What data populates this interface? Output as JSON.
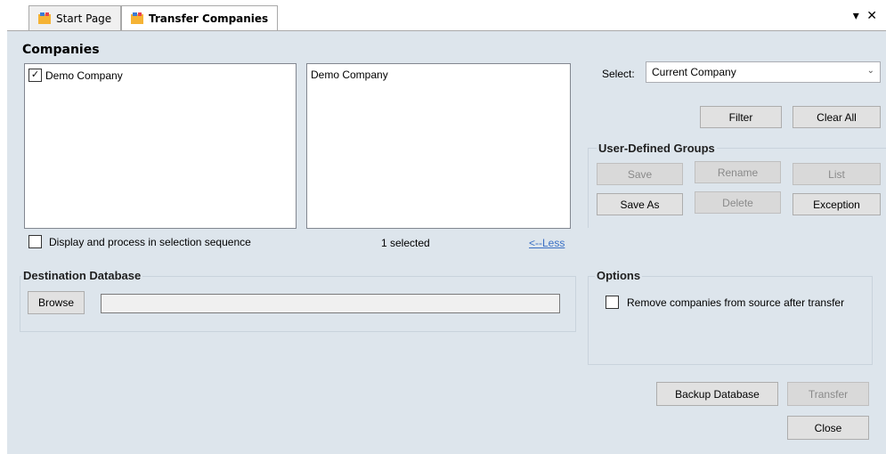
{
  "tabs": {
    "start_page": "Start Page",
    "transfer_companies": "Transfer Companies"
  },
  "window_controls": {
    "dropdown": "▾",
    "close": "✕"
  },
  "companies": {
    "title": "Companies",
    "source_items": [
      {
        "label": "Demo Company",
        "checked": true
      }
    ],
    "selected_items": [
      "Demo Company"
    ],
    "sequence_label": "Display and process in selection sequence",
    "selected_count": "1 selected",
    "less_link": "<--Less"
  },
  "select": {
    "label": "Select:",
    "value": "Current Company"
  },
  "filter_button": "Filter",
  "clear_all_button": "Clear All",
  "user_groups": {
    "title": "User-Defined Groups",
    "save": "Save",
    "rename": "Rename",
    "list": "List",
    "save_as": "Save As",
    "delete": "Delete",
    "exception": "Exception"
  },
  "destination": {
    "title": "Destination Database",
    "browse": "Browse",
    "path": ""
  },
  "options": {
    "title": "Options",
    "remove_label": "Remove companies from source after transfer"
  },
  "actions": {
    "backup": "Backup Database",
    "transfer": "Transfer",
    "close": "Close"
  }
}
